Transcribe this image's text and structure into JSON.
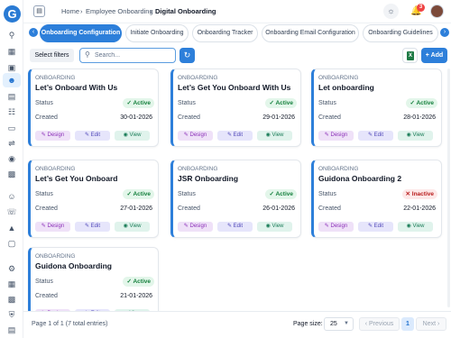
{
  "app": {
    "logo_letter": "G"
  },
  "header": {
    "breadcrumbs": [
      "Home",
      "Employee Onboarding",
      "Digital Onboarding"
    ],
    "separator": "›",
    "notification_count": "3"
  },
  "tabs": [
    {
      "label": "Onboarding Configuration",
      "active": true
    },
    {
      "label": "Initiate Onboarding",
      "active": false
    },
    {
      "label": "Onboarding Tracker",
      "active": false
    },
    {
      "label": "Onboarding Email Configuration",
      "active": false
    },
    {
      "label": "Onboarding Guidelines",
      "active": false
    }
  ],
  "toolbar": {
    "filters_label": "Select filters",
    "search_placeholder": "Search...",
    "add_label": "+ Add",
    "excel_icon": "X"
  },
  "labels": {
    "status": "Status",
    "created": "Created",
    "design": "Design",
    "edit": "Edit",
    "view": "View"
  },
  "cards": [
    {
      "category": "ONBOARDING",
      "title": "Let’s Onboard With Us",
      "status": "Active",
      "created": "30-01-2026"
    },
    {
      "category": "ONBOARDING",
      "title": "Let’s Get You Onboard With Us",
      "status": "Active",
      "created": "29-01-2026"
    },
    {
      "category": "ONBOARDING",
      "title": "Let onboarding",
      "status": "Active",
      "created": "28-01-2026"
    },
    {
      "category": "ONBOARDING",
      "title": "Let’s Get You Onboard",
      "status": "Active",
      "created": "27-01-2026"
    },
    {
      "category": "ONBOARDING",
      "title": "JSR Onboarding",
      "status": "Active",
      "created": "26-01-2026"
    },
    {
      "category": "ONBOARDING",
      "title": "Guidona Onboarding 2",
      "status": "Inactive",
      "created": "22-01-2026"
    },
    {
      "category": "ONBOARDING",
      "title": "Guidona Onboarding",
      "status": "Active",
      "created": "21-01-2026"
    }
  ],
  "pagination": {
    "info": "Page 1 of 1 (7 total entries)",
    "page_size_label": "Page size:",
    "page_size": "25",
    "previous": "‹ Previous",
    "current_page": "1",
    "next": "Next ›"
  },
  "colors": {
    "accent": "#2d7fda",
    "active_badge": "#15803d",
    "inactive_badge": "#b91c1c"
  },
  "sidebar_icons": [
    "search-icon",
    "grid-icon",
    "briefcase-icon",
    "user-icon",
    "calendar-icon",
    "document-icon",
    "folder-icon",
    "network-icon",
    "location-icon",
    "clipboard-icon",
    "users-icon",
    "phone-icon",
    "graduation-icon",
    "box-icon",
    "settings-icon",
    "grid-small-icon",
    "chart-icon",
    "shield-icon",
    "file-icon"
  ]
}
